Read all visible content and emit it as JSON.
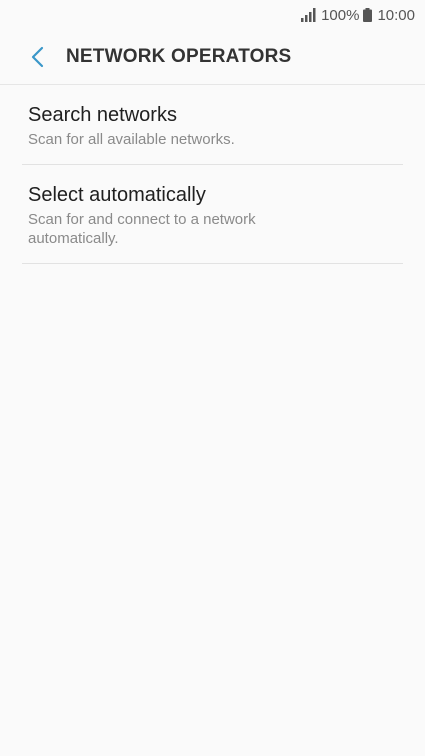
{
  "status": {
    "battery_pct": "100%",
    "time": "10:00",
    "signal_icon": "signal-icon",
    "battery_icon": "battery-icon"
  },
  "header": {
    "title": "NETWORK OPERATORS",
    "back_icon": "chevron-left-icon",
    "accent": "#3a97c9"
  },
  "items": [
    {
      "title": "Search networks",
      "subtitle": "Scan for all available networks."
    },
    {
      "title": "Select automatically",
      "subtitle": "Scan for and connect to a network automatically."
    }
  ]
}
